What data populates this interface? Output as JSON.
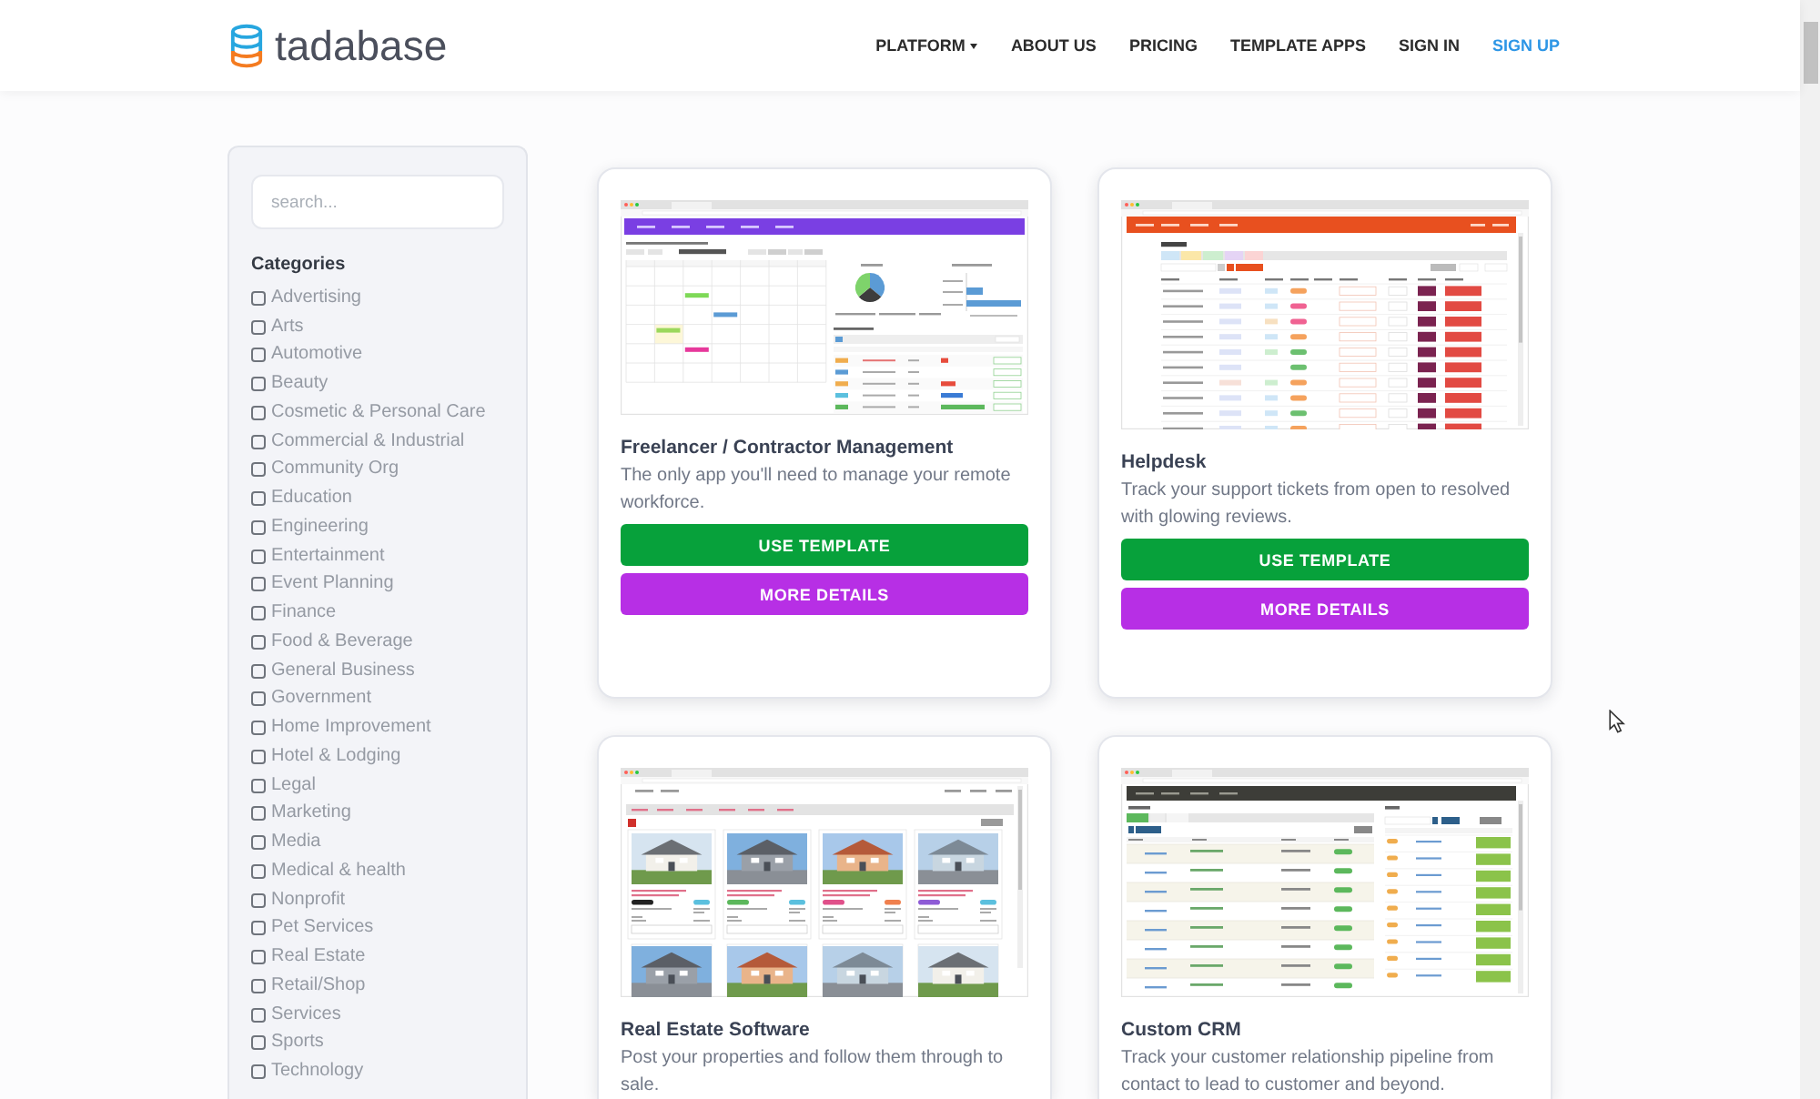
{
  "header": {
    "logo": {
      "text": "tadabase"
    },
    "nav": [
      {
        "label": "PLATFORM",
        "kind": "dropdown"
      },
      {
        "label": "ABOUT US",
        "kind": "link"
      },
      {
        "label": "PRICING",
        "kind": "link"
      },
      {
        "label": "TEMPLATE APPS",
        "kind": "link"
      },
      {
        "label": "SIGN IN",
        "kind": "link"
      },
      {
        "label": "SIGN UP",
        "kind": "highlight"
      }
    ]
  },
  "sidebar": {
    "search": {
      "placeholder": "search..."
    },
    "heading": "Categories",
    "categories": [
      {
        "label": "Advertising",
        "checked": false
      },
      {
        "label": "Arts",
        "checked": false
      },
      {
        "label": "Automotive",
        "checked": false
      },
      {
        "label": "Beauty",
        "checked": false
      },
      {
        "label": "Cosmetic & Personal Care",
        "checked": false
      },
      {
        "label": "Commercial & Industrial",
        "checked": false
      },
      {
        "label": "Community Org",
        "checked": false
      },
      {
        "label": "Education",
        "checked": false
      },
      {
        "label": "Engineering",
        "checked": false
      },
      {
        "label": "Entertainment",
        "checked": false
      },
      {
        "label": "Event Planning",
        "checked": false
      },
      {
        "label": "Finance",
        "checked": false
      },
      {
        "label": "Food & Beverage",
        "checked": false
      },
      {
        "label": "General Business",
        "checked": false
      },
      {
        "label": "Government",
        "checked": false
      },
      {
        "label": "Home Improvement",
        "checked": false
      },
      {
        "label": "Hotel & Lodging",
        "checked": false
      },
      {
        "label": "Legal",
        "checked": false
      },
      {
        "label": "Marketing",
        "checked": false
      },
      {
        "label": "Media",
        "checked": false
      },
      {
        "label": "Medical & health",
        "checked": false
      },
      {
        "label": "Nonprofit",
        "checked": false
      },
      {
        "label": "Pet Services",
        "checked": false
      },
      {
        "label": "Real Estate",
        "checked": false
      },
      {
        "label": "Retail/Shop",
        "checked": false
      },
      {
        "label": "Services",
        "checked": false
      },
      {
        "label": "Sports",
        "checked": false
      },
      {
        "label": "Technology",
        "checked": false
      }
    ]
  },
  "templates": [
    {
      "kind": "calendar",
      "title": "Freelancer / Contractor Management",
      "description": "The only app you'll need to manage your remote workforce.",
      "buttons": [
        {
          "label": "USE TEMPLATE",
          "kind": "use"
        },
        {
          "label": "MORE DETAILS",
          "kind": "details"
        }
      ]
    },
    {
      "kind": "tickets",
      "title": "Helpdesk",
      "description": "Track your support tickets from open to resolved with glowing reviews.",
      "buttons": [
        {
          "label": "USE TEMPLATE",
          "kind": "use"
        },
        {
          "label": "MORE DETAILS",
          "kind": "details"
        }
      ]
    },
    {
      "kind": "listings",
      "title": "Real Estate Software",
      "description": "Post your properties and follow them through to sale."
    },
    {
      "kind": "crm",
      "title": "Custom CRM",
      "description": "Track your customer relationship pipeline from contact to lead to customer and beyond."
    }
  ]
}
